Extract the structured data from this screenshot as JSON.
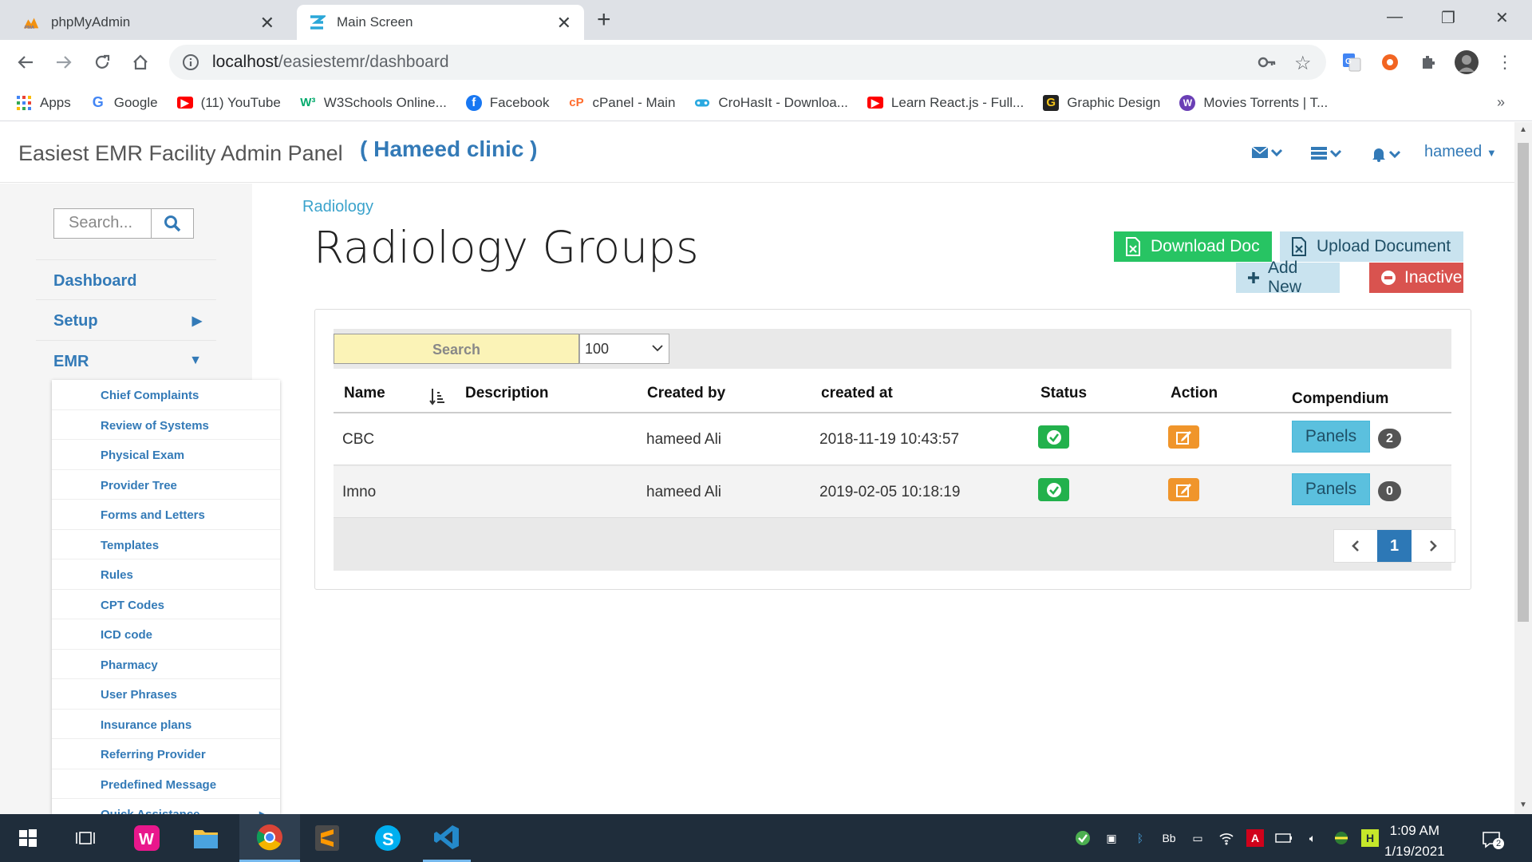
{
  "browser": {
    "tabs": [
      {
        "title": "phpMyAdmin",
        "icon": "phpmyadmin-icon",
        "active": false
      },
      {
        "title": "Main Screen",
        "icon": "app-z-icon",
        "active": true
      }
    ],
    "url_host": "localhost",
    "url_path": "/easiestemr/dashboard",
    "bookmarks": [
      {
        "label": "Apps",
        "icon": "apps-grid-icon",
        "color": "#4285f4"
      },
      {
        "label": "Google",
        "icon": "google-icon",
        "color": "#4285f4"
      },
      {
        "label": "(11) YouTube",
        "icon": "youtube-icon",
        "color": "#ff0000"
      },
      {
        "label": "W3Schools Online...",
        "icon": "w3schools-icon",
        "color": "#04aa6d"
      },
      {
        "label": "Facebook",
        "icon": "facebook-icon",
        "color": "#1877f2"
      },
      {
        "label": "cPanel - Main",
        "icon": "cpanel-icon",
        "color": "#ff6c2c"
      },
      {
        "label": "CroHasIt - Downloa...",
        "icon": "gamepad-icon",
        "color": "#2aa9e0"
      },
      {
        "label": "Learn React.js - Full...",
        "icon": "youtube-icon",
        "color": "#ff0000"
      },
      {
        "label": "Graphic Design",
        "icon": "graphic-design-icon",
        "color": "#222222"
      },
      {
        "label": "Movies Torrents | T...",
        "icon": "movies-icon",
        "color": "#6a3fb5"
      }
    ]
  },
  "app": {
    "name": "Easiest EMR Facility Admin Panel",
    "clinic": "( Hameed clinic )",
    "user": "hameed",
    "accent": "#337ab7"
  },
  "sidebar": {
    "search_placeholder": "Search...",
    "items": [
      {
        "label": "Dashboard",
        "arrow": ""
      },
      {
        "label": "Setup",
        "arrow": "▶"
      },
      {
        "label": "EMR",
        "arrow": "▼"
      }
    ],
    "submenu": [
      "Chief Complaints",
      "Review of Systems",
      "Physical Exam",
      "Provider Tree",
      "Forms and Letters",
      "Templates",
      "Rules",
      "CPT Codes",
      "ICD code",
      "Pharmacy",
      "User Phrases",
      "Insurance plans",
      "Referring Provider",
      "Predefined Message",
      "Quick Assistance"
    ]
  },
  "page": {
    "breadcrumb": "Radiology",
    "title": "Radiology Groups",
    "buttons": {
      "download": "Download Doc",
      "upload": "Upload Document",
      "add_new": "Add New",
      "inactive": "Inactive"
    }
  },
  "table": {
    "search_label": "Search",
    "page_size": "100",
    "columns": [
      "Name",
      "Description",
      "Created by",
      "created at",
      "Status",
      "Action",
      "Compendium"
    ],
    "rows": [
      {
        "name": "CBC",
        "description": "",
        "created_by": "hameed Ali",
        "created_at": "2018-11-19 10:43:57",
        "panels_label": "Panels",
        "panels_count": "2"
      },
      {
        "name": "Imno",
        "description": "",
        "created_by": "hameed Ali",
        "created_at": "2019-02-05 10:18:19",
        "panels_label": "Panels",
        "panels_count": "0"
      }
    ],
    "pagination": {
      "current": "1"
    }
  },
  "taskbar": {
    "time": "1:09 AM",
    "date": "1/19/2021",
    "notifications": "2"
  }
}
